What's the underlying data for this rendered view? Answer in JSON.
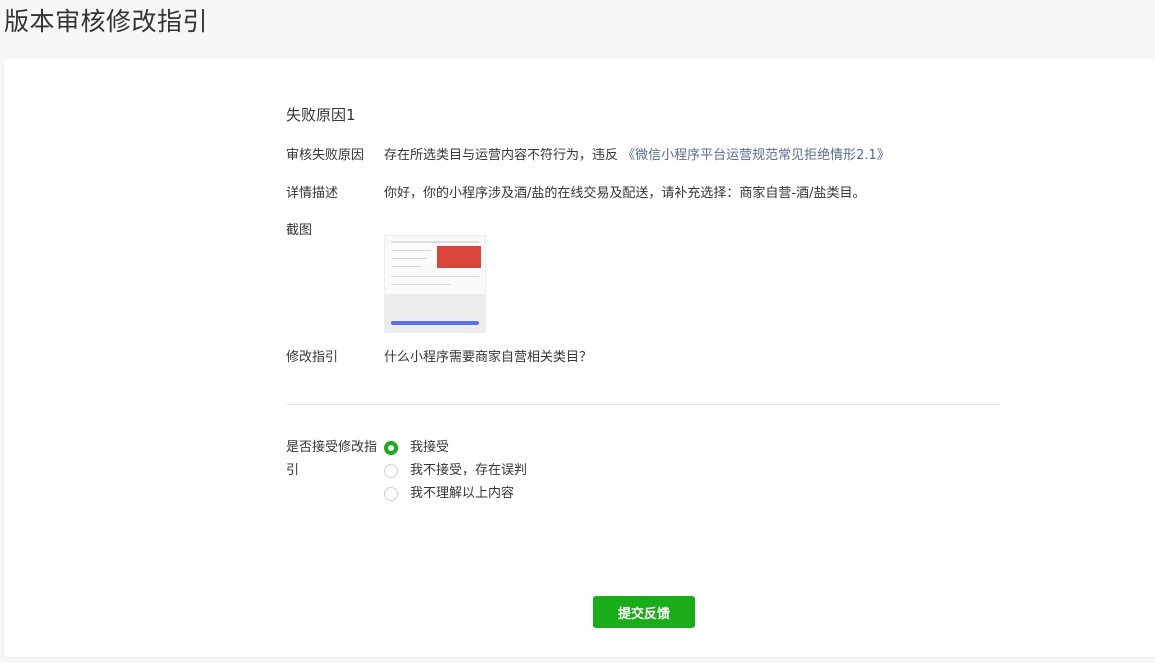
{
  "page": {
    "title": "版本审核修改指引"
  },
  "failure": {
    "section_title": "失败原因1",
    "reason_label": "审核失败原因",
    "reason_text": "存在所选类目与运营内容不符行为，违反",
    "reason_link": "《微信小程序平台运营规范常见拒绝情形2.1》",
    "detail_label": "详情描述",
    "detail_text": "你好，你的小程序涉及酒/盐的在线交易及配送，请补充选择：商家自营-酒/盐类目。",
    "screenshot_label": "截图",
    "guide_label": "修改指引",
    "guide_link": "什么小程序需要商家自营相关类目？"
  },
  "acceptance": {
    "label": "是否接受修改指引",
    "options": [
      {
        "label": "我接受",
        "checked": true
      },
      {
        "label": "我不接受，存在误判",
        "checked": false
      },
      {
        "label": "我不理解以上内容",
        "checked": false
      }
    ]
  },
  "submit_label": "提交反馈",
  "colors": {
    "accent": "#1aad19",
    "link": "#576b95"
  }
}
